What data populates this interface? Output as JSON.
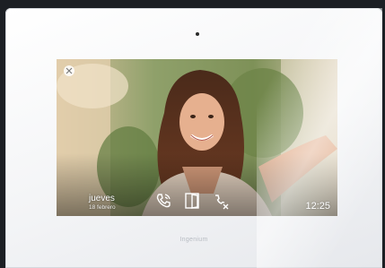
{
  "device": {
    "brand": "Ingenium"
  },
  "screen": {
    "day": "jueves",
    "date": "18 febrero",
    "time": "12:25"
  },
  "icons": {
    "close": "close-icon",
    "answer": "phone-answer-icon",
    "door": "door-open-icon",
    "hangup": "phone-hangup-icon"
  },
  "colors": {
    "frame": "#f3f4f6",
    "overlay_text": "#ffffff"
  }
}
